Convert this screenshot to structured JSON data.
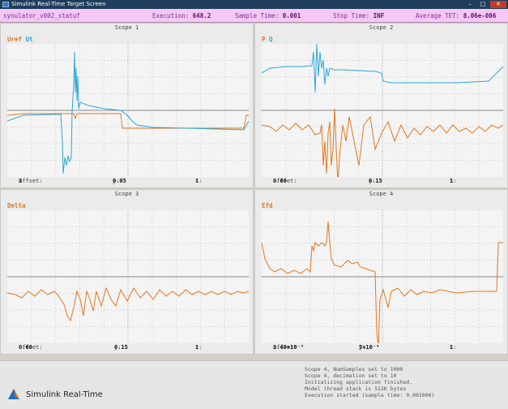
{
  "window": {
    "title": "Simulink Real-Time Target Screen",
    "minimize": "–",
    "maximize": "□",
    "close": "✕"
  },
  "status": {
    "model_name": "synulator_v002_statuf",
    "execution_label": "Execution:",
    "execution_value": "648.2",
    "sample_time_label": "Sample Time:",
    "sample_time_value": "0.001",
    "stop_time_label": "Stop Time:",
    "stop_time_value": "INF",
    "tet_label": "Average TET:",
    "tet_value": "8.06e-006"
  },
  "colors": {
    "orange": "#e0781e",
    "blue": "#2aa8d8",
    "status_bg": "#f6c6f4"
  },
  "scopes": [
    {
      "title": "Scope 1",
      "legend": [
        {
          "text": "Uref",
          "color": "#e0781e"
        },
        {
          "text": "Ut",
          "color": "#2aa8d8"
        }
      ],
      "offset_label": "Offset:",
      "offset_value": "1",
      "y_label": "y:",
      "y_value": "0.05",
      "t_label": "t:",
      "t_value": "1"
    },
    {
      "title": "Scope 2",
      "legend": [
        {
          "text": "P",
          "color": "#e0781e"
        },
        {
          "text": "Q",
          "color": "#2aa8d8"
        }
      ],
      "offset_label": "Offset:",
      "offset_value": "0.60",
      "y_label": "y:",
      "y_value": "0.15",
      "t_label": "t:",
      "t_value": "1"
    },
    {
      "title": "Scope 3",
      "legend": [
        {
          "text": "Delta",
          "color": "#e0781e"
        }
      ],
      "offset_label": "Offset:",
      "offset_value": "0.60",
      "y_label": "y:",
      "y_value": "0.15",
      "t_label": "t:",
      "t_value": "1"
    },
    {
      "title": "Scope 4",
      "legend": [
        {
          "text": "Efd",
          "color": "#e0781e"
        }
      ],
      "offset_label": "Offset:",
      "offset_value": "1.40×10⁻³",
      "y_label": "y:",
      "y_value": "5×10⁻⁴",
      "t_label": "t:",
      "t_value": "1"
    }
  ],
  "log_lines": [
    "Scope 4, NumSamples set to 1000",
    "Scope 4, decimation set to 10",
    "Initializing application finished.",
    "Model thread stack is 512K bytes",
    "Execution started (sample time: 0.001000)"
  ],
  "branding": {
    "logo_text": "Simulink Real-Time",
    "logo_icon": "simulink-logo-icon"
  }
}
